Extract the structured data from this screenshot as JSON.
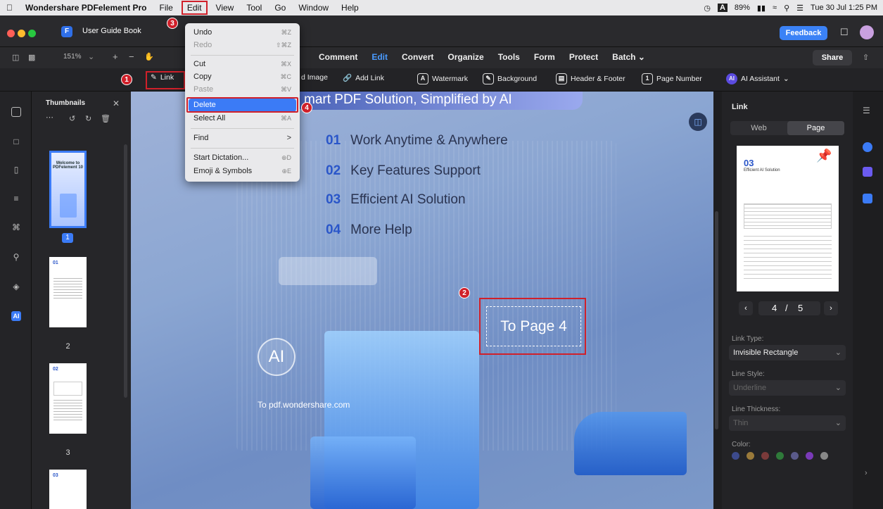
{
  "menubar": {
    "app_name": "Wondershare PDFelement Pro",
    "items": [
      "File",
      "Edit",
      "View",
      "Tool",
      "Go",
      "Window",
      "Help"
    ],
    "battery": "89%",
    "datetime": "Tue 30 Jul  1:25 PM"
  },
  "window": {
    "tab_title": "User Guide Book",
    "feedback_label": "Feedback",
    "share_label": "Share",
    "zoom": "151%"
  },
  "nav_tabs": [
    "Comment",
    "Edit",
    "Convert",
    "Organize",
    "Tools",
    "Form",
    "Protect",
    "Batch"
  ],
  "active_tab": "Edit",
  "edit_toolbar": {
    "link": "Link",
    "add_image": "d Image",
    "add_link": "Add Link",
    "watermark": "Watermark",
    "background": "Background",
    "header_footer": "Header & Footer",
    "page_number": "Page Number",
    "ai_assistant": "AI Assistant"
  },
  "edit_menu": {
    "undo": {
      "label": "Undo",
      "shortcut": "⌘Z"
    },
    "redo": {
      "label": "Redo",
      "shortcut": "⇧⌘Z"
    },
    "cut": {
      "label": "Cut",
      "shortcut": "⌘X"
    },
    "copy": {
      "label": "Copy",
      "shortcut": "⌘C"
    },
    "paste": {
      "label": "Paste",
      "shortcut": "⌘V"
    },
    "delete": {
      "label": "Delete"
    },
    "select_all": {
      "label": "Select All",
      "shortcut": "⌘A"
    },
    "find": {
      "label": "Find",
      "shortcut": ">"
    },
    "dictation": {
      "label": "Start Dictation...",
      "shortcut": "⊕D"
    },
    "emoji": {
      "label": "Emoji & Symbols",
      "shortcut": "⊕E"
    }
  },
  "thumbnails": {
    "title": "Thumbnails",
    "pages": [
      "1",
      "2",
      "3"
    ],
    "page1_title": "Welcome to PDFelement 10",
    "page2_heading": "01",
    "page3_heading": "02",
    "page4_heading": "03"
  },
  "document": {
    "banner": "mart PDF Solution, Simplified by AI",
    "toc": [
      {
        "num": "01",
        "text": "Work Anytime & Anywhere"
      },
      {
        "num": "02",
        "text": "Key Features Support"
      },
      {
        "num": "03",
        "text": "Efficient AI Solution"
      },
      {
        "num": "04",
        "text": "More Help"
      }
    ],
    "link_text": "To Page 4",
    "ai_badge": "AI",
    "url_text": "To pdf.wondershare.com"
  },
  "link_panel": {
    "title": "Link",
    "tab_web": "Web",
    "tab_page": "Page",
    "preview_heading": "03",
    "preview_subtitle": "Efficient AI Solution",
    "current_page": "4",
    "total_pages": "5",
    "page_sep": "/",
    "link_type_label": "Link Type:",
    "link_type_value": "Invisible Rectangle",
    "line_style_label": "Line Style:",
    "line_style_value": "Underline",
    "line_thickness_label": "Line Thickness:",
    "line_thickness_value": "Thin",
    "color_label": "Color:",
    "colors": [
      "#3c4a8c",
      "#9a7a3a",
      "#7a3a3a",
      "#2f7a3a",
      "#5a5a8a",
      "#7a3ab8",
      "#888888"
    ]
  },
  "step_badges": [
    "1",
    "2",
    "3",
    "4"
  ]
}
